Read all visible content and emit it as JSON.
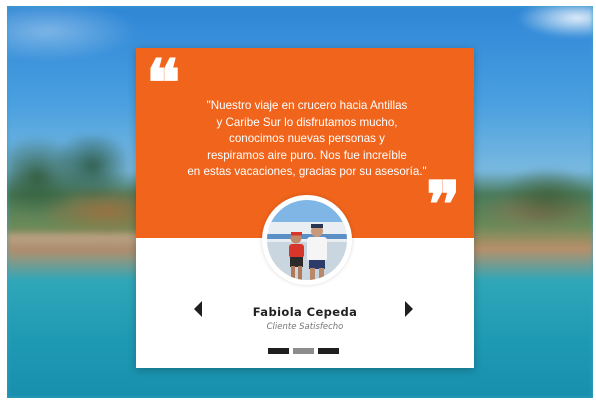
{
  "testimonial": {
    "quote_lines": [
      "\"Nuestro viaje en crucero hacia Antillas",
      "y Caribe Sur lo disfrutamos mucho,",
      "conocimos nuevas personas y",
      "respiramos aire puro. Nos fue increíble",
      "en estas vacaciones, gracias por su asesoría.\""
    ],
    "quote_open_mark": "❝",
    "quote_close_mark": "❞",
    "name": "Fabiola Cepeda",
    "role": "Cliente Satisfecho"
  },
  "navigation": {
    "prev_icon": "arrow-left-icon",
    "next_icon": "arrow-right-icon"
  },
  "pagination": {
    "slides": 3,
    "active_index": 1
  },
  "colors": {
    "accent": "#f0641c",
    "card": "#ffffff",
    "text_dark": "#222222",
    "text_muted": "#777777",
    "dot_active": "#8c8c8c",
    "dot_inactive": "#1f1f1f"
  }
}
